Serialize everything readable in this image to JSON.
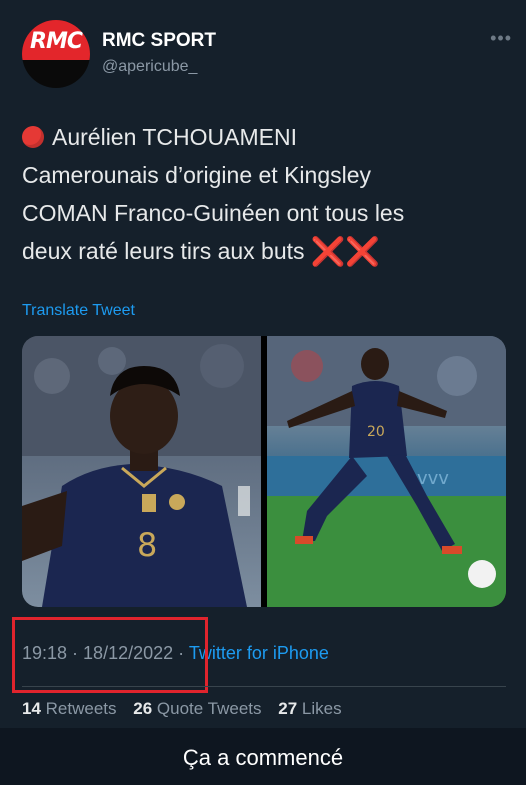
{
  "account": {
    "logo_text": "RMC",
    "name": "RMC SPORT",
    "handle": "@apericube_",
    "more_icon": "more-icon"
  },
  "tweet": {
    "lines": [
      "Aurélien TCHOUAMENI",
      "Camerounais d’origine et Kingsley",
      "COMAN Franco-Guinéen  ont tous les",
      "deux raté leurs tirs aux buts"
    ],
    "leading_icon": "red-circle-icon",
    "trailing_icon": "double-cross-icon",
    "trailing_marks": "❌❌",
    "translate_label": "Translate Tweet"
  },
  "media": {
    "left": {
      "jersey_number": "8"
    },
    "right": {
      "jersey_number": "20"
    }
  },
  "meta": {
    "time": "19:18",
    "date": "18/12/2022",
    "via": "Twitter for iPhone"
  },
  "stats": {
    "retweets_count": "14",
    "retweets_label": "Retweets",
    "quotes_count": "26",
    "quotes_label": "Quote Tweets",
    "likes_count": "27",
    "likes_label": "Likes"
  },
  "caption": "Ça a commencé",
  "colors": {
    "background": "#15202b",
    "accent": "#1d9bf0",
    "highlight": "#e0242d",
    "brand": "#e3262b"
  }
}
